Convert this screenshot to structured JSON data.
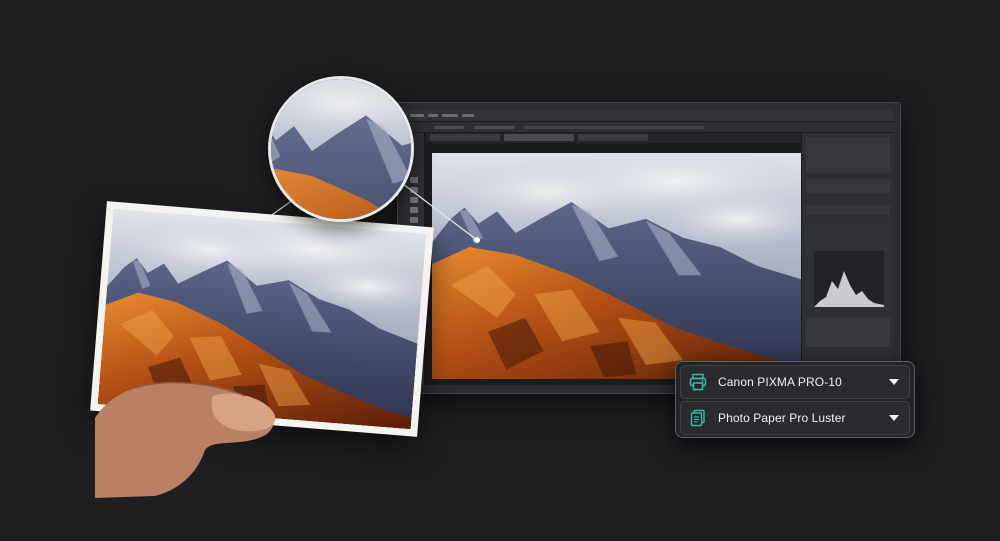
{
  "print_dialog": {
    "printer": {
      "label": "Canon PIXMA PRO-10",
      "icon": "printer-icon"
    },
    "paper": {
      "label": "Photo Paper Pro Luster",
      "icon": "document-icon"
    },
    "accent_color": "#3fb7ad"
  }
}
